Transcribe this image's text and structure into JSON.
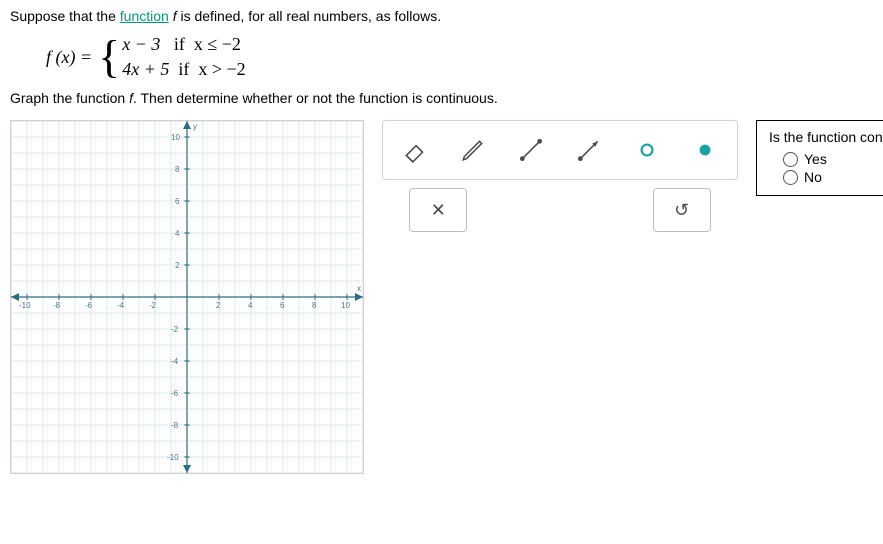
{
  "problem": {
    "intro_pre": "Suppose that the ",
    "link_text": "function",
    "intro_mid": " ",
    "intro_fname": "f",
    "intro_post": " is defined, for all real numbers, as follows.",
    "lhs": "f (x) = ",
    "piece1_expr": "x − 3",
    "piece1_cond": "if  x ≤ −2",
    "piece2_expr": "4x + 5",
    "piece2_cond": "if  x > −2",
    "task_pre": "Graph the function ",
    "task_fname": "f",
    "task_post": ". Then determine whether or not the function is continuous."
  },
  "graph": {
    "xlabel": "x",
    "ylabel": "y",
    "ticks_pos": [
      "2",
      "4",
      "6",
      "8",
      "10"
    ],
    "ticks_neg": [
      "-2",
      "-4",
      "-6",
      "-8",
      "-10"
    ]
  },
  "tools": {
    "t1": "eraser-icon",
    "t2": "pencil-icon",
    "t3": "segment-closed-icon",
    "t4": "segment-open-icon",
    "t5": "open-point-icon",
    "t6": "closed-point-icon",
    "clear": "✕",
    "reset": "↺"
  },
  "question": {
    "title": "Is the function continuous?",
    "opt_yes": "Yes",
    "opt_no": "No"
  }
}
